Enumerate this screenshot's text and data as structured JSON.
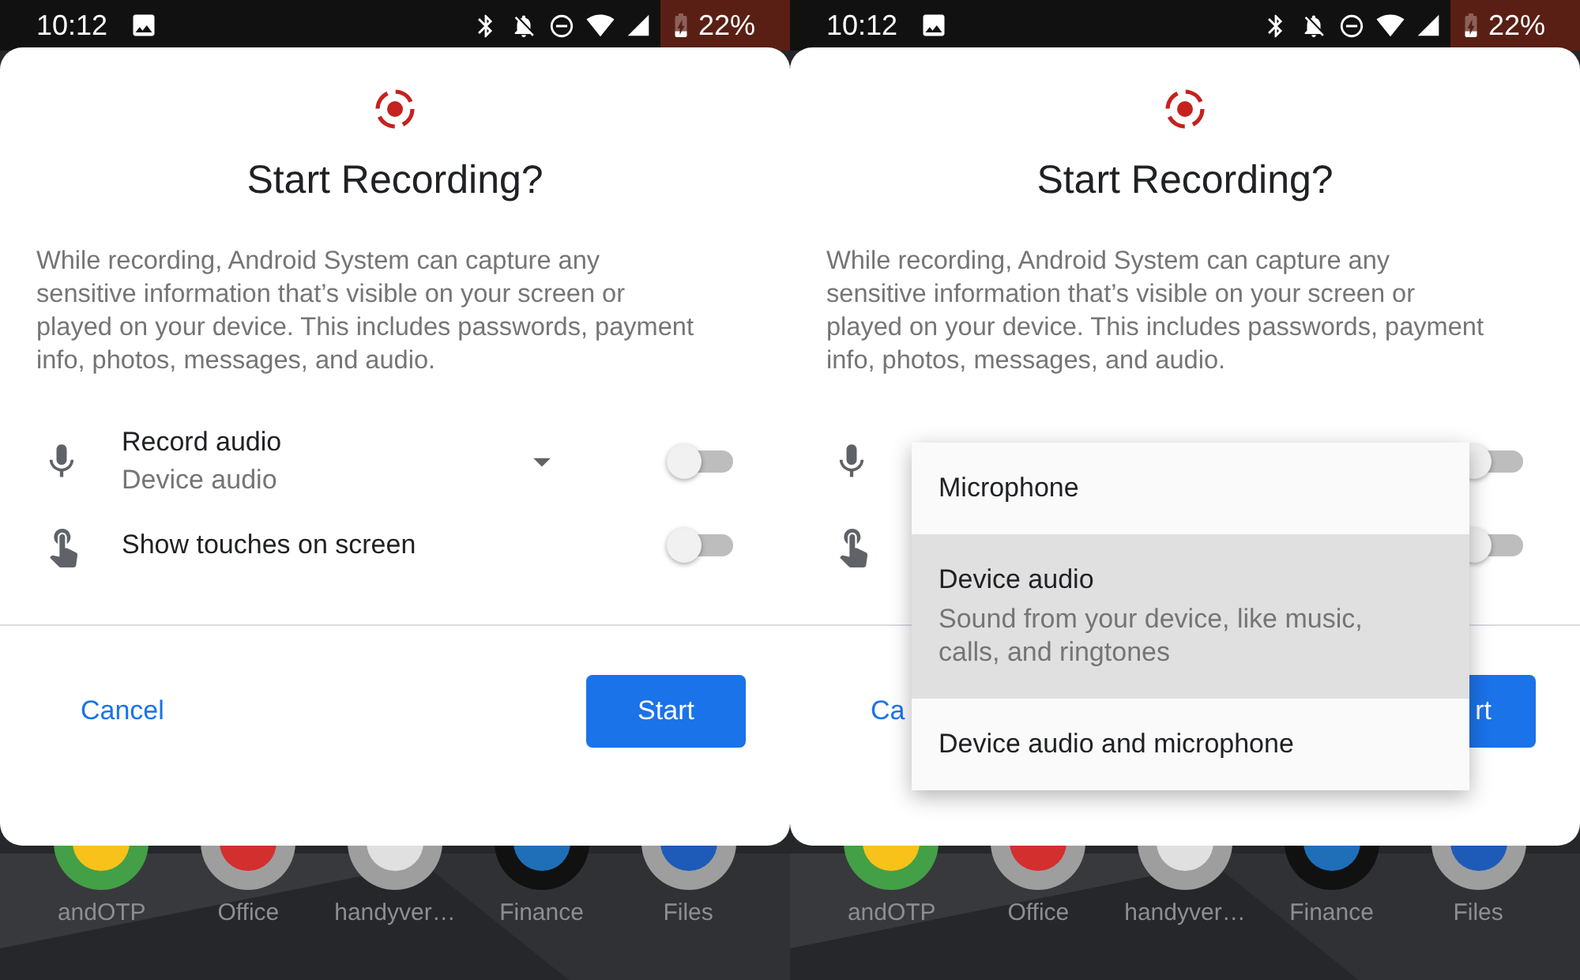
{
  "screens": [
    {
      "status_bar": {
        "time": "10:12",
        "battery": "22%"
      },
      "dialog": {
        "title": "Start Recording?",
        "body": "While recording, Android System can capture any sensitive information that’s visible on your screen or played on your device. This includes passwords, payment info, photos, messages, and audio.",
        "options": [
          {
            "kind": "dropdown",
            "label": "Record audio",
            "value": "Device audio",
            "on": false
          },
          {
            "kind": "switch",
            "label": "Show touches on screen",
            "on": false
          }
        ],
        "cancel": "Cancel",
        "start": "Start"
      },
      "apps": [
        "andOTP",
        "Office",
        "handyver…",
        "Finance",
        "Files"
      ]
    },
    {
      "status_bar": {
        "time": "10:12",
        "battery": "22%"
      },
      "dialog": {
        "title": "Start Recording?",
        "body": "While recording, Android System can capture any sensitive information that’s visible on your screen or played on your device. This includes passwords, payment info, photos, messages, and audio.",
        "options": [
          {
            "kind": "dropdown",
            "on": false
          },
          {
            "kind": "switch",
            "on": false
          }
        ],
        "cancel": "Ca",
        "start": "rt"
      },
      "menu": [
        {
          "label": "Microphone",
          "selected": false
        },
        {
          "label": "Device audio",
          "description": "Sound from your device, like music, calls, and ringtones",
          "selected": true
        },
        {
          "label": "Device audio and microphone",
          "selected": false
        }
      ],
      "apps": [
        "andOTP",
        "Office",
        "handyver…",
        "Finance",
        "Files"
      ]
    }
  ]
}
